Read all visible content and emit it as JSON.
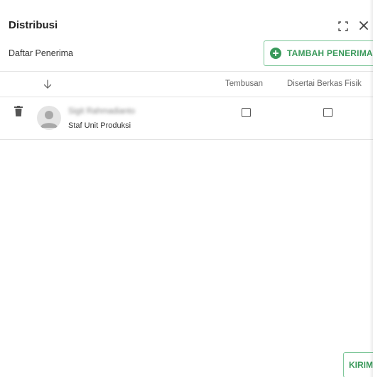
{
  "dialog": {
    "title": "Distribusi",
    "subtitle": "Daftar Penerima",
    "add_button_label": "TAMBAH PENERIMA",
    "send_button_label": "KIRIM"
  },
  "table": {
    "columns": [
      "Tembusan",
      "Disertai Berkas Fisik"
    ],
    "rows": [
      {
        "name": "Sigit Rahmadianto",
        "role": "Staf Unit Produksi",
        "tembusan": false,
        "berkas_fisik": false
      }
    ]
  },
  "icons": {
    "expand": "expand-icon",
    "close": "close-icon",
    "add": "plus-circle-icon",
    "sort": "arrow-down-icon",
    "delete": "trash-icon",
    "avatar": "person-icon"
  },
  "colors": {
    "accent": "#3a9a5b",
    "accent_border": "#7fc79a"
  }
}
